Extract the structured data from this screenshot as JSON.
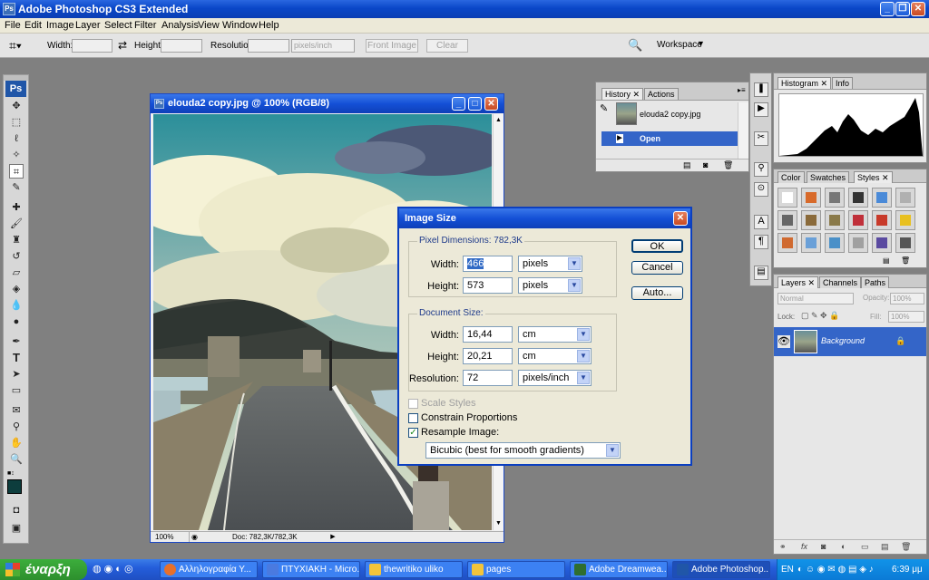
{
  "app": {
    "title": "Adobe Photoshop CS3 Extended",
    "logo": "Ps"
  },
  "menu": [
    "File",
    "Edit",
    "Image",
    "Layer",
    "Select",
    "Filter",
    "Analysis",
    "View",
    "Window",
    "Help"
  ],
  "options": {
    "width_label": "Width:",
    "height_label": "Height:",
    "resolution_label": "Resolution:",
    "resolution_unit": "pixels/inch",
    "front_image": "Front Image",
    "clear": "Clear",
    "workspace": "Workspace"
  },
  "document": {
    "title": "elouda2 copy.jpg @ 100% (RGB/8)",
    "zoom": "100%",
    "doc_size": "Doc: 782,3K/782,3K"
  },
  "history_panel": {
    "tabs": [
      "History",
      "Actions"
    ],
    "snapshot": "elouda2 copy.jpg",
    "step": "Open"
  },
  "histogram_panel": {
    "tabs": [
      "Histogram",
      "Info"
    ]
  },
  "styles_panel": {
    "tabs": [
      "Color",
      "Swatches",
      "Styles"
    ],
    "swatch_colors": [
      "#ffffff",
      "#d86a2a",
      "#777777",
      "#333333",
      "#4a8ad8",
      "#b0b0b0",
      "#666666",
      "#8a6a3a",
      "#8a7a4a",
      "#c0303a",
      "#c83a2a",
      "#e8c020",
      "#d06a30",
      "#6aa0d8",
      "#4a90c8",
      "#a0a0a0",
      "#5a4aa0",
      "#555555"
    ]
  },
  "layers_panel": {
    "tabs": [
      "Layers",
      "Channels",
      "Paths"
    ],
    "blend_mode": "Normal",
    "opacity_label": "Opacity:",
    "opacity": "100%",
    "lock_label": "Lock:",
    "fill_label": "Fill:",
    "fill": "100%",
    "layer_name": "Background"
  },
  "dialog": {
    "title": "Image Size",
    "pixel_dimensions_label": "Pixel Dimensions:",
    "pixel_dimensions_value": "782,3K",
    "width_label": "Width:",
    "height_label": "Height:",
    "pixel_width": "466",
    "pixel_height": "573",
    "pixel_unit": "pixels",
    "document_size_label": "Document Size:",
    "doc_width": "16,44",
    "doc_height": "20,21",
    "doc_unit": "cm",
    "resolution_label": "Resolution:",
    "resolution": "72",
    "resolution_unit": "pixels/inch",
    "scale_styles": "Scale Styles",
    "constrain": "Constrain Proportions",
    "resample": "Resample Image:",
    "resample_method": "Bicubic (best for smooth gradients)",
    "ok": "OK",
    "cancel": "Cancel",
    "auto": "Auto..."
  },
  "taskbar": {
    "start": "έναρξη",
    "items": [
      "Αλληλογραφία Υ...",
      "ΠΤΥΧΙΑΚΗ - Micro...",
      "thewritiko uliko",
      "pages",
      "Adobe Dreamwea...",
      "Adobe Photoshop..."
    ],
    "lang": "EN",
    "time": "6:39 μμ"
  }
}
